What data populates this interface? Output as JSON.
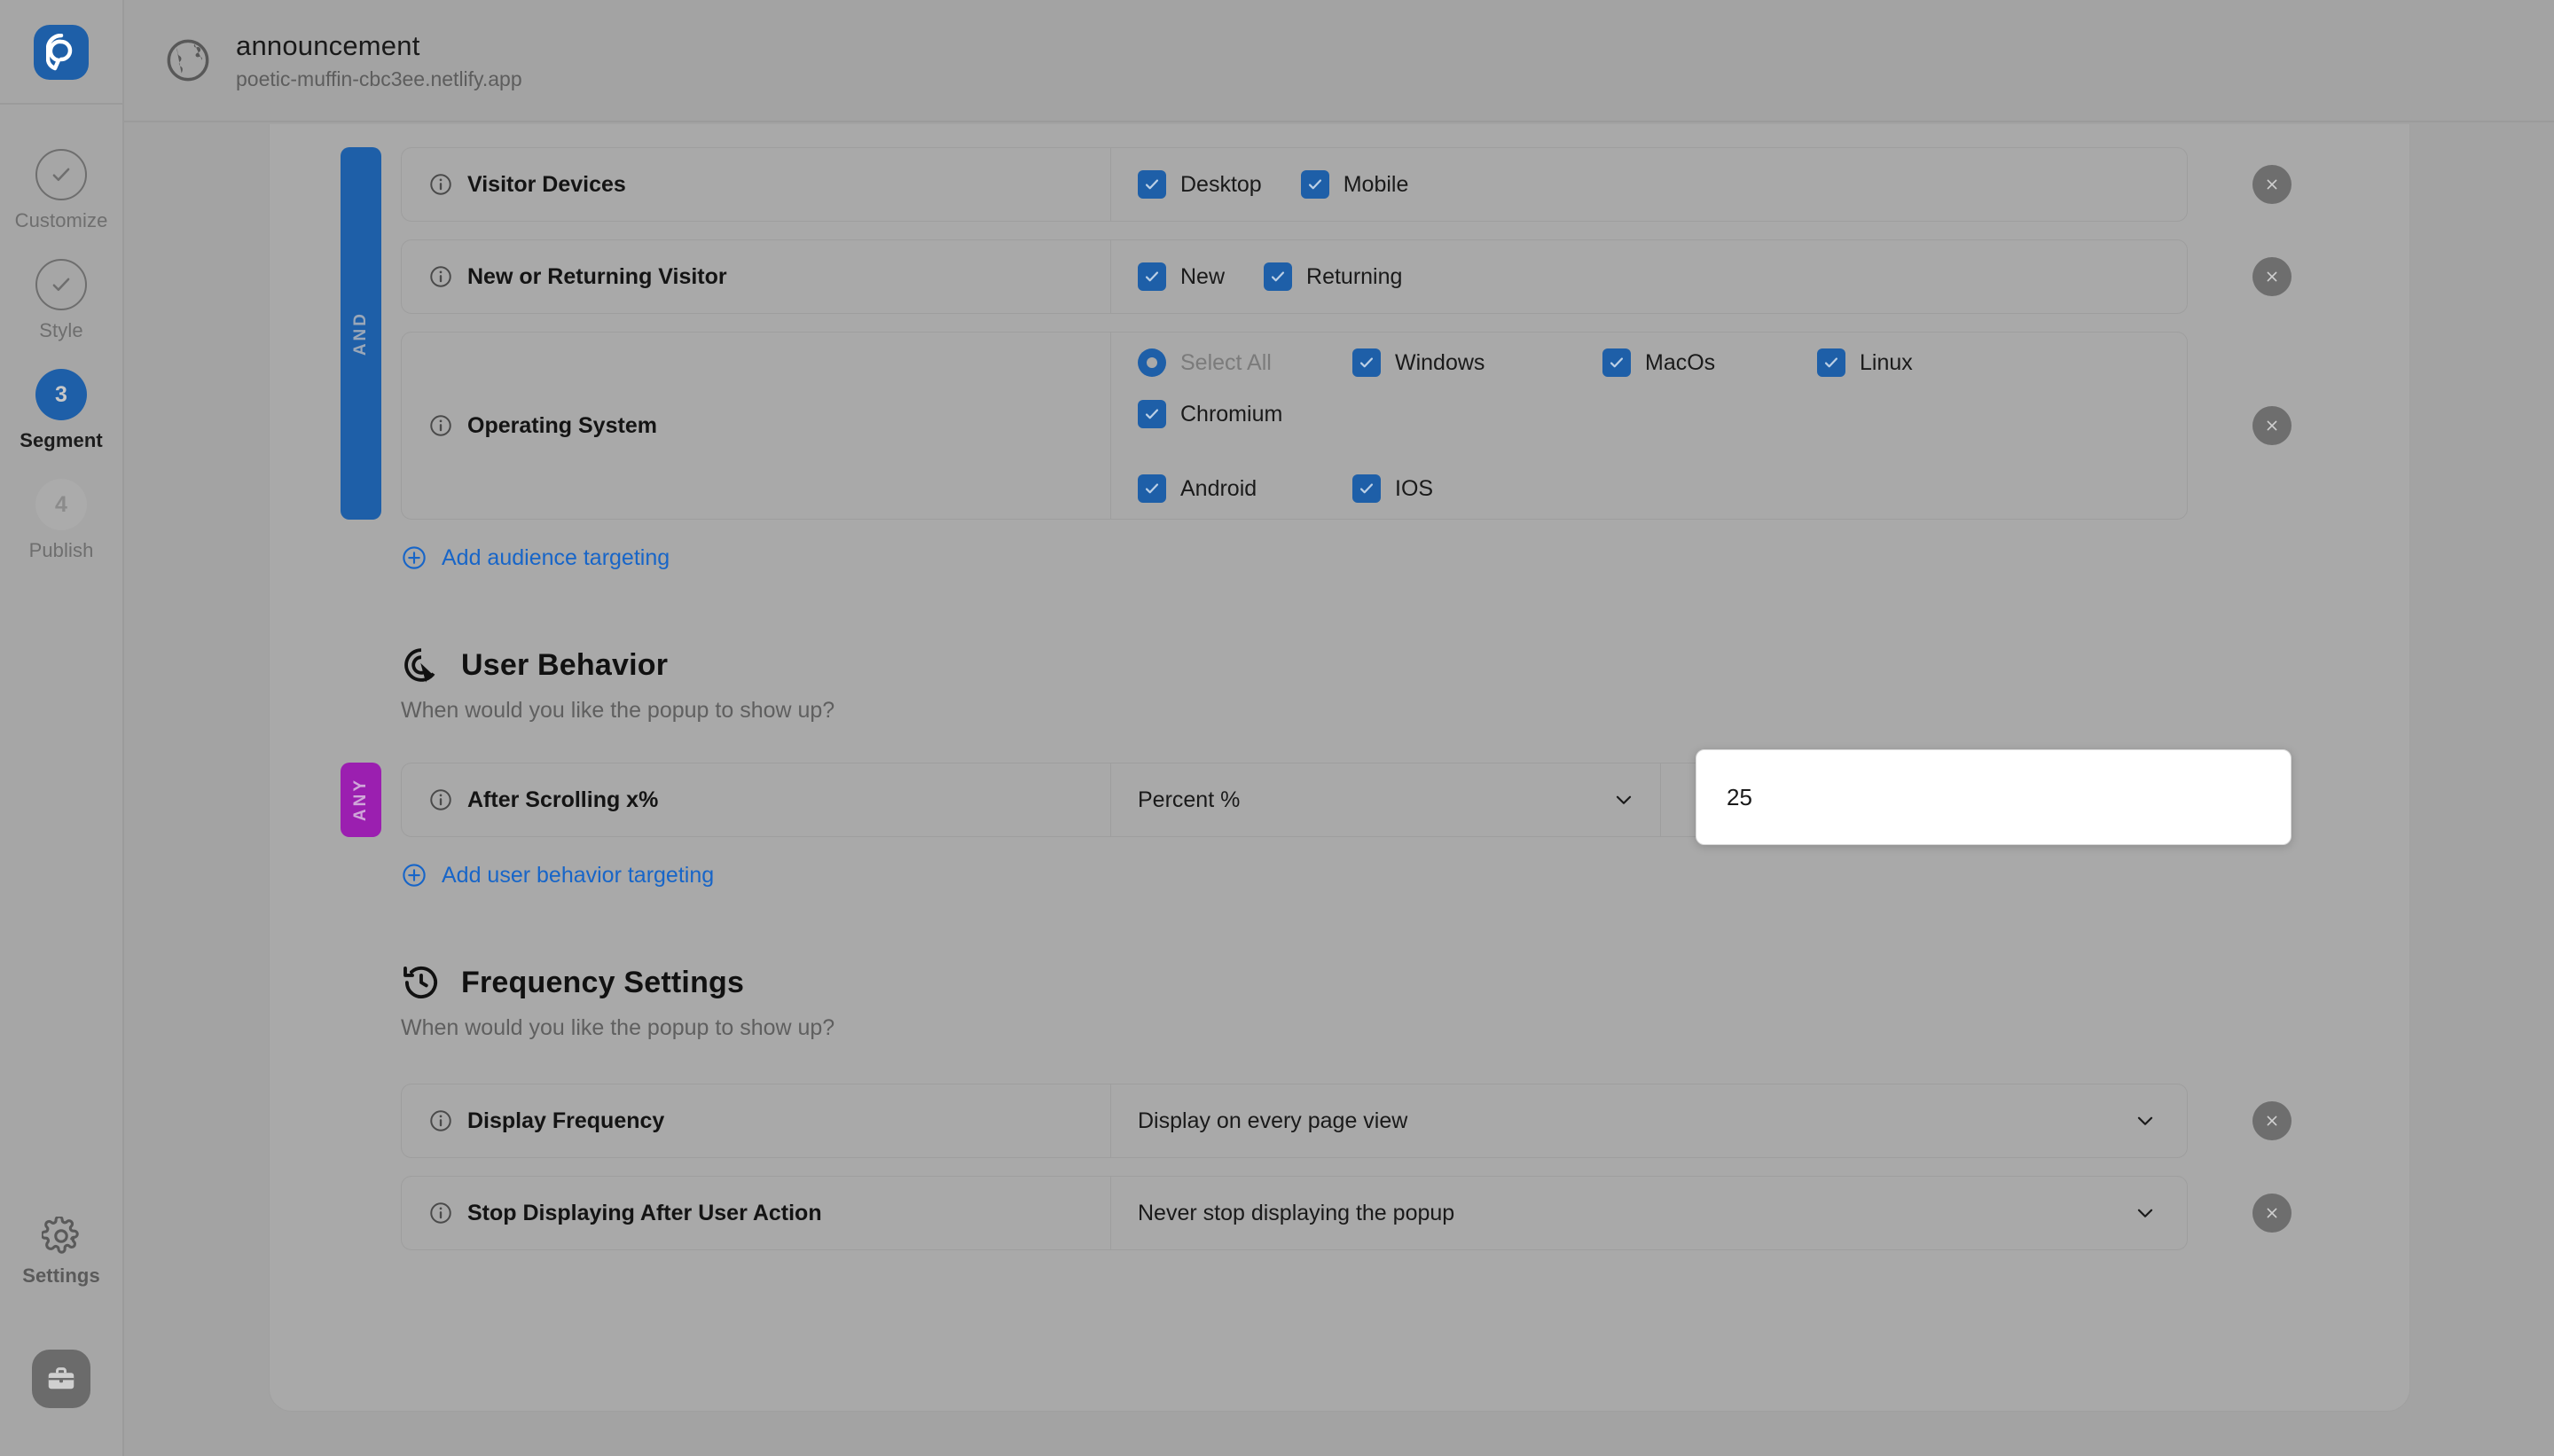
{
  "app": {
    "logo_icon": "popupsmart-logo-icon",
    "avatar_icon": "briefcase-icon"
  },
  "header": {
    "globe_icon": "globe-icon",
    "title": "announcement",
    "url": "poetic-muffin-cbc3ee.netlify.app"
  },
  "sidebar": {
    "steps": [
      {
        "label": "Customize",
        "badge": "",
        "state": "done",
        "icon": "check-circle-icon"
      },
      {
        "label": "Style",
        "badge": "",
        "state": "done",
        "icon": "check-circle-icon"
      },
      {
        "label": "Segment",
        "badge": "3",
        "state": "active",
        "icon": ""
      },
      {
        "label": "Publish",
        "badge": "4",
        "state": "idle",
        "icon": ""
      }
    ],
    "settings": {
      "label": "Settings",
      "icon": "gear-icon"
    }
  },
  "audience": {
    "conjunction": "AND",
    "rows": [
      {
        "label": "Visitor Devices",
        "info_icon": "info-icon",
        "remove_icon": "close-icon",
        "options": [
          {
            "label": "Desktop",
            "type": "checkbox",
            "checked": true
          },
          {
            "label": "Mobile",
            "type": "checkbox",
            "checked": true
          }
        ]
      },
      {
        "label": "New or Returning Visitor",
        "info_icon": "info-icon",
        "remove_icon": "close-icon",
        "options": [
          {
            "label": "New",
            "type": "checkbox",
            "checked": true
          },
          {
            "label": "Returning",
            "type": "checkbox",
            "checked": true
          }
        ]
      },
      {
        "label": "Operating System",
        "info_icon": "info-icon",
        "remove_icon": "close-icon",
        "options": [
          {
            "label": "Select All",
            "type": "ring",
            "checked": false
          },
          {
            "label": "Windows",
            "type": "checkbox",
            "checked": true
          },
          {
            "label": "MacOs",
            "type": "checkbox",
            "checked": true
          },
          {
            "label": "Linux",
            "type": "checkbox",
            "checked": true
          },
          {
            "label": "Chromium",
            "type": "checkbox",
            "checked": true
          },
          {
            "label": "Android",
            "type": "checkbox",
            "checked": true
          },
          {
            "label": "IOS",
            "type": "checkbox",
            "checked": true
          }
        ]
      }
    ],
    "add_link": {
      "label": "Add audience targeting",
      "icon": "plus-circle-icon"
    }
  },
  "user_behavior": {
    "icon": "cursor-target-icon",
    "title": "User Behavior",
    "subtitle": "When would you like the popup to show up?",
    "conjunction": "ANY",
    "row": {
      "label": "After Scrolling x%",
      "info_icon": "info-icon",
      "remove_icon": "close-icon",
      "select_value": "Percent %",
      "chevron_icon": "chevron-down-icon",
      "input_value": "25"
    },
    "add_link": {
      "label": "Add user behavior targeting",
      "icon": "plus-circle-icon"
    }
  },
  "frequency": {
    "icon": "history-clock-icon",
    "title": "Frequency Settings",
    "subtitle": "When would you like the popup to show up?",
    "rows": [
      {
        "label": "Display Frequency",
        "info_icon": "info-icon",
        "remove_icon": "close-icon",
        "value": "Display on every page view",
        "chevron_icon": "chevron-down-icon"
      },
      {
        "label": "Stop Displaying After User Action",
        "info_icon": "info-icon",
        "remove_icon": "close-icon",
        "value": "Never stop displaying the popup",
        "chevron_icon": "chevron-down-icon"
      }
    ]
  },
  "colors": {
    "brand_blue": "#1e5fa8",
    "link_blue": "#1765c8",
    "any_purple": "#9b1fb0",
    "page_bg": "#a3a3a3",
    "panel_bg": "#a9a9a9"
  }
}
